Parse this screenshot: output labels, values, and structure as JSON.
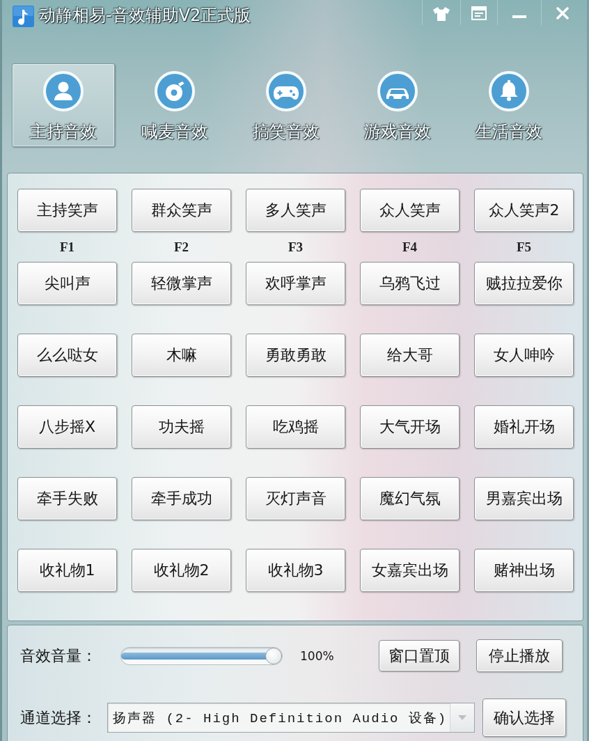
{
  "window": {
    "title": "动静相易-音效辅助V2正式版"
  },
  "tabs": [
    {
      "label": "主持音效",
      "selected": true
    },
    {
      "label": "喊麦音效",
      "selected": false
    },
    {
      "label": "搞笑音效",
      "selected": false
    },
    {
      "label": "游戏音效",
      "selected": false
    },
    {
      "label": "生活音效",
      "selected": false
    }
  ],
  "sound_grid": {
    "rows": [
      {
        "buttons": [
          {
            "label": "主持笑声",
            "hotkey": "F1"
          },
          {
            "label": "群众笑声",
            "hotkey": "F2"
          },
          {
            "label": "多人笑声",
            "hotkey": "F3"
          },
          {
            "label": "众人笑声",
            "hotkey": "F4"
          },
          {
            "label": "众人笑声2",
            "hotkey": "F5"
          }
        ]
      },
      {
        "buttons": [
          {
            "label": "尖叫声"
          },
          {
            "label": "轻微掌声"
          },
          {
            "label": "欢呼掌声"
          },
          {
            "label": "乌鸦飞过"
          },
          {
            "label": "贼拉拉爱你"
          }
        ]
      },
      {
        "buttons": [
          {
            "label": "么么哒女"
          },
          {
            "label": "木嘛"
          },
          {
            "label": "勇敢勇敢"
          },
          {
            "label": "给大哥"
          },
          {
            "label": "女人呻吟"
          }
        ]
      },
      {
        "buttons": [
          {
            "label": "八步摇X"
          },
          {
            "label": "功夫摇"
          },
          {
            "label": "吃鸡摇"
          },
          {
            "label": "大气开场"
          },
          {
            "label": "婚礼开场"
          }
        ]
      },
      {
        "buttons": [
          {
            "label": "牵手失败"
          },
          {
            "label": "牵手成功"
          },
          {
            "label": "灭灯声音"
          },
          {
            "label": "魔幻气氛"
          },
          {
            "label": "男嘉宾出场"
          }
        ]
      },
      {
        "buttons": [
          {
            "label": "收礼物1"
          },
          {
            "label": "收礼物2"
          },
          {
            "label": "收礼物3"
          },
          {
            "label": "女嘉宾出场"
          },
          {
            "label": "赌神出场"
          }
        ]
      }
    ]
  },
  "volume": {
    "label": "音效音量：",
    "level": 1.0,
    "reading": "100%"
  },
  "panel_buttons": [
    {
      "label": "窗口置顶"
    },
    {
      "label": "停止播放"
    }
  ],
  "channel": {
    "label": "通道选择：",
    "value": "扬声器 (2- High Definition Audio 设备)",
    "confirm_button": "确认选择"
  }
}
